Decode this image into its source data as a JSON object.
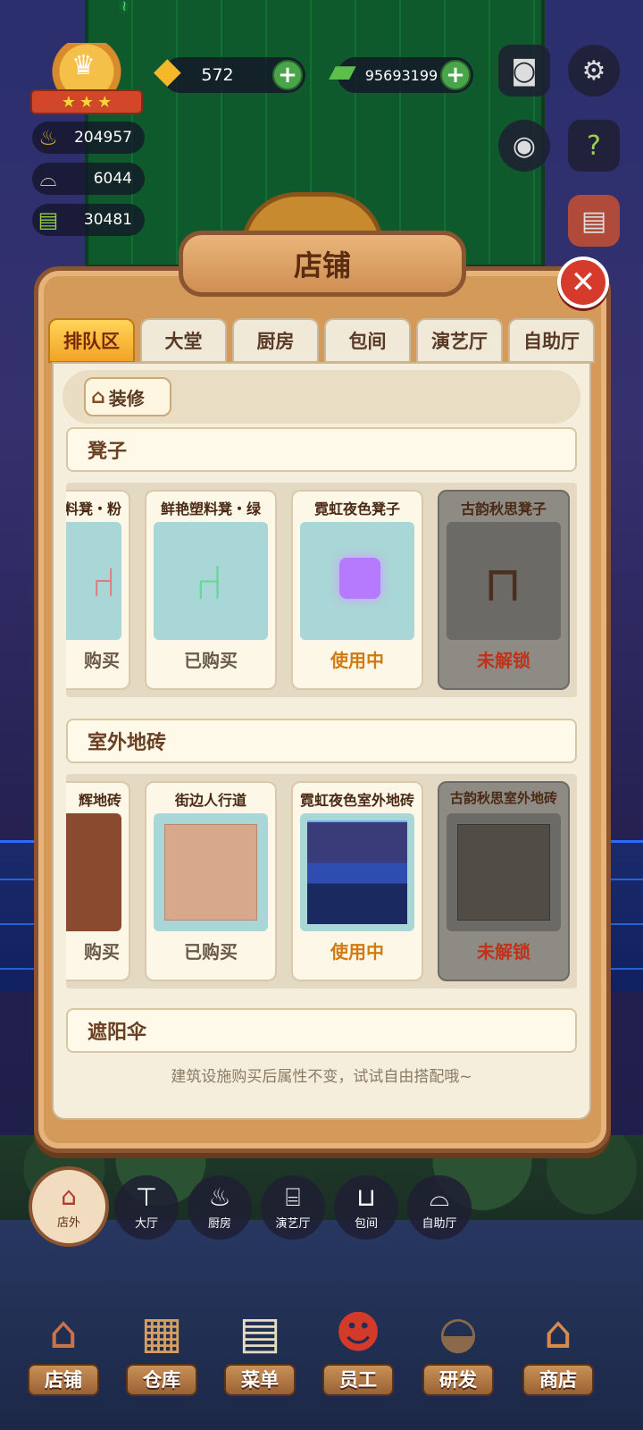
{
  "hud": {
    "stats": [
      {
        "icon": "pot-icon",
        "value": "204957"
      },
      {
        "icon": "cloche-icon",
        "value": "6044"
      },
      {
        "icon": "book-icon",
        "value": "30481"
      }
    ],
    "gold": {
      "icon": "gold-ingot-icon",
      "value": "572"
    },
    "cash": {
      "icon": "cash-stack-icon",
      "value": "95693199"
    },
    "right_buttons": [
      "camera-icon",
      "gear-icon",
      "eye-icon",
      "help-book-icon",
      "recipe-book-icon"
    ]
  },
  "panel": {
    "title": "店铺",
    "tabs": [
      "排队区",
      "大堂",
      "厨房",
      "包间",
      "演艺厅",
      "自助厅"
    ],
    "active_tab": "排队区",
    "decorate_label": "装修",
    "sections": [
      {
        "title": "凳子",
        "items": [
          {
            "name": "料凳・粉",
            "status": "购买",
            "state": "purchased"
          },
          {
            "name": "鲜艳塑料凳・绿",
            "status": "已购买",
            "state": "purchased"
          },
          {
            "name": "霓虹夜色凳子",
            "status": "使用中",
            "state": "in-use"
          },
          {
            "name": "古韵秋思凳子",
            "status": "未解锁",
            "state": "locked"
          }
        ]
      },
      {
        "title": "室外地砖",
        "items": [
          {
            "name": "辉地砖",
            "status": "购买",
            "state": "purchased"
          },
          {
            "name": "街边人行道",
            "status": "已购买",
            "state": "purchased"
          },
          {
            "name": "霓虹夜色室外地砖",
            "status": "使用中",
            "state": "in-use"
          },
          {
            "name": "古韵秋思室外地砖",
            "status": "未解锁",
            "state": "locked"
          }
        ]
      },
      {
        "title": "遮阳伞",
        "items": []
      }
    ],
    "footer_note": "建筑设施购买后属性不变，试试自由搭配哦~"
  },
  "category_bar": [
    {
      "label": "店外",
      "icon": "storefront-icon",
      "active": true
    },
    {
      "label": "大厅",
      "icon": "table-icon",
      "active": false
    },
    {
      "label": "厨房",
      "icon": "pot-icon",
      "active": false
    },
    {
      "label": "演艺厅",
      "icon": "stage-icon",
      "active": false
    },
    {
      "label": "包间",
      "icon": "sofa-icon",
      "active": false
    },
    {
      "label": "自助厅",
      "icon": "cloche-icon",
      "active": false
    }
  ],
  "bottom_nav": [
    {
      "label": "店铺",
      "icon": "shop-building-icon"
    },
    {
      "label": "仓库",
      "icon": "boxes-icon"
    },
    {
      "label": "菜单",
      "icon": "clipboard-icon"
    },
    {
      "label": "员工",
      "icon": "chef-icon"
    },
    {
      "label": "研发",
      "icon": "wok-icon"
    },
    {
      "label": "商店",
      "icon": "market-stall-icon"
    }
  ],
  "colors": {
    "panel_wood": "#d49a5a",
    "tab_active": "#f2a324",
    "in_use": "#d07a12",
    "locked": "#c0321a",
    "plus_green": "#4aa54a",
    "close_red": "#d63a2a"
  }
}
